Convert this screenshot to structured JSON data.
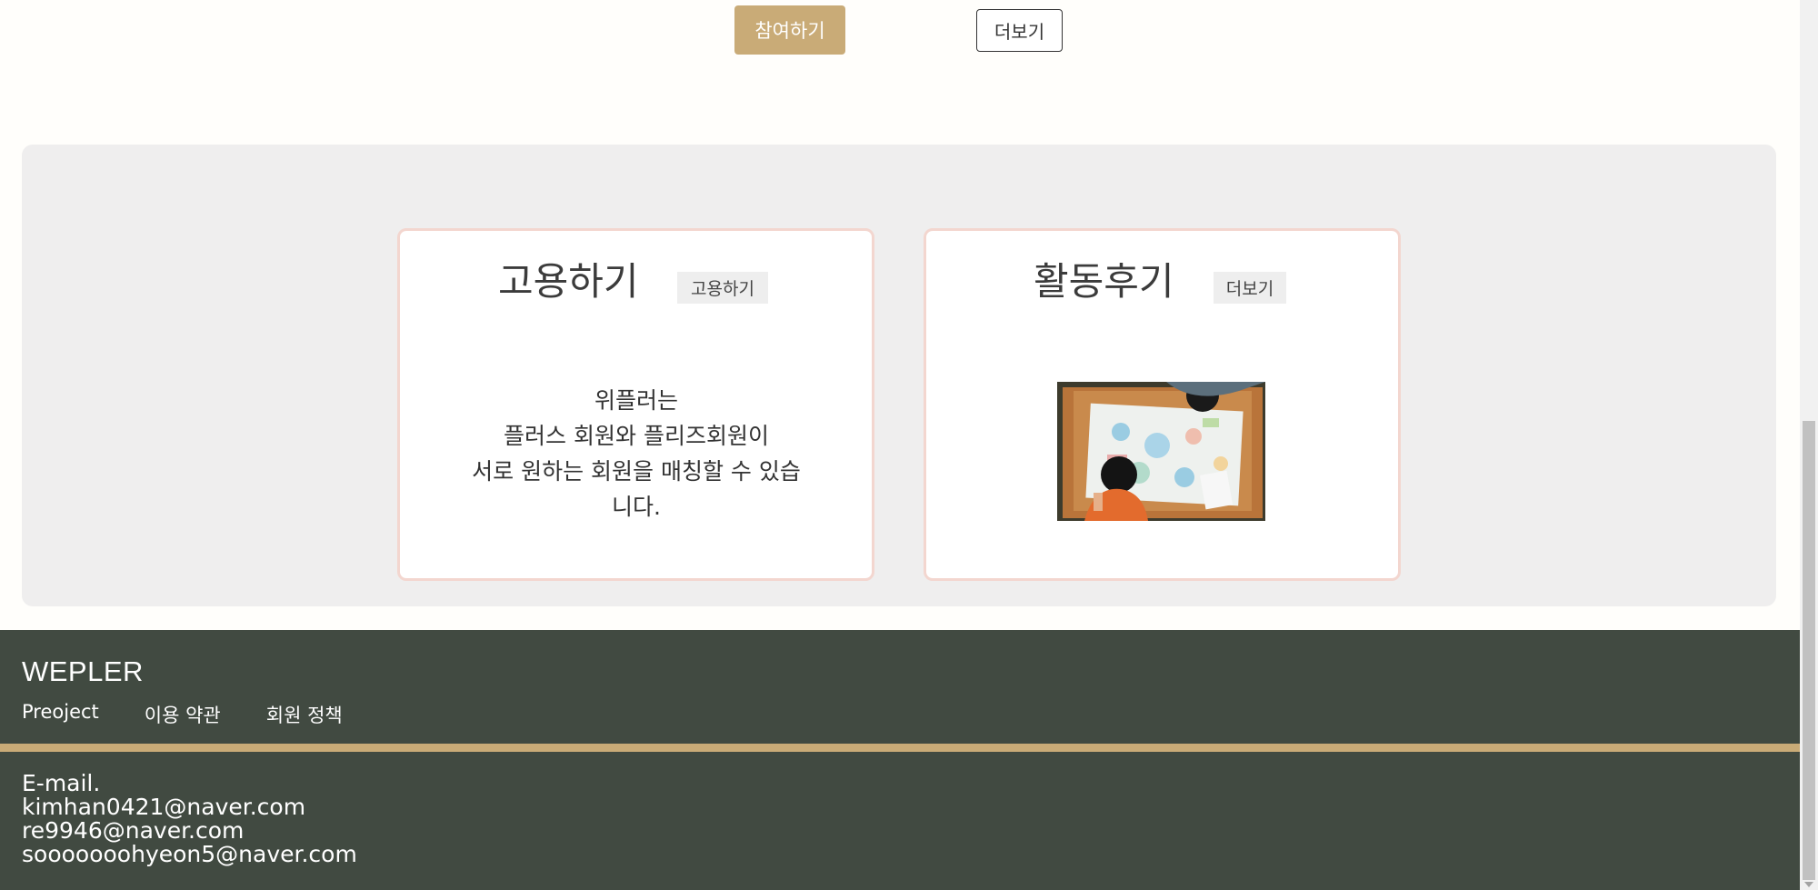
{
  "top_buttons": {
    "join_label": "참여하기",
    "more_label": "더보기"
  },
  "hire_card": {
    "title": "고용하기",
    "button_label": "고용하기",
    "description_lines": [
      "위플러는",
      "플러스 회원와 플리즈회원이",
      "서로 원하는 회원을 매칭할 수 있습",
      "니다."
    ]
  },
  "review_card": {
    "title": "활동후기",
    "button_label": "더보기",
    "image_icon": "children-drawing-photo"
  },
  "footer": {
    "brand": "WEPLER",
    "links": [
      "Preoject",
      "이용 약관",
      "회원 정책"
    ],
    "contact_label": "E-mail.",
    "emails": [
      "kimhan0421@naver.com",
      "re9946@naver.com",
      "sooooooohyeon5@naver.com"
    ]
  },
  "colors": {
    "accent_gold": "#c9ab77",
    "footer_bg": "#414a41",
    "card_border": "#f3d6cf",
    "section_bg": "#efeeee"
  }
}
